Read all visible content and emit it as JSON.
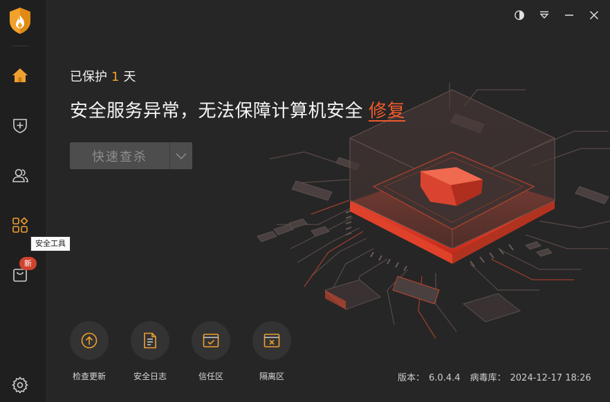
{
  "sidebar": {
    "logo_icon": "flame-shield-logo",
    "items": [
      {
        "name": "home",
        "icon": "home-icon",
        "active": true
      },
      {
        "name": "virus-scan",
        "icon": "shield-plus-icon"
      },
      {
        "name": "account",
        "icon": "users-icon"
      },
      {
        "name": "tools",
        "icon": "apps-grid-icon",
        "tooltip": "安全工具"
      },
      {
        "name": "store",
        "icon": "bag-icon",
        "badge": "新"
      },
      {
        "name": "settings",
        "icon": "gear-icon"
      }
    ]
  },
  "window_controls": [
    "theme-icon",
    "menu-icon",
    "minimize-icon",
    "close-icon"
  ],
  "hero": {
    "protect_prefix": "已保护",
    "protect_days": "1",
    "protect_suffix": "天",
    "status_text": "安全服务异常，无法保障计算机安全",
    "fix_link": "修复",
    "scan_button": "快速查杀"
  },
  "tools": [
    {
      "label": "检查更新",
      "icon": "upload-arrow-icon"
    },
    {
      "label": "安全日志",
      "icon": "document-icon"
    },
    {
      "label": "信任区",
      "icon": "trust-window-icon"
    },
    {
      "label": "隔离区",
      "icon": "quarantine-window-icon"
    }
  ],
  "footer": {
    "version_label": "版本：",
    "version_value": "6.0.4.4",
    "db_label": "病毒库：",
    "db_value": "2024-12-17 18:26"
  },
  "colors": {
    "accent": "#f2a12b",
    "danger": "#ef5a2c",
    "background": "#262626",
    "sidebar": "#1f1f1f"
  }
}
